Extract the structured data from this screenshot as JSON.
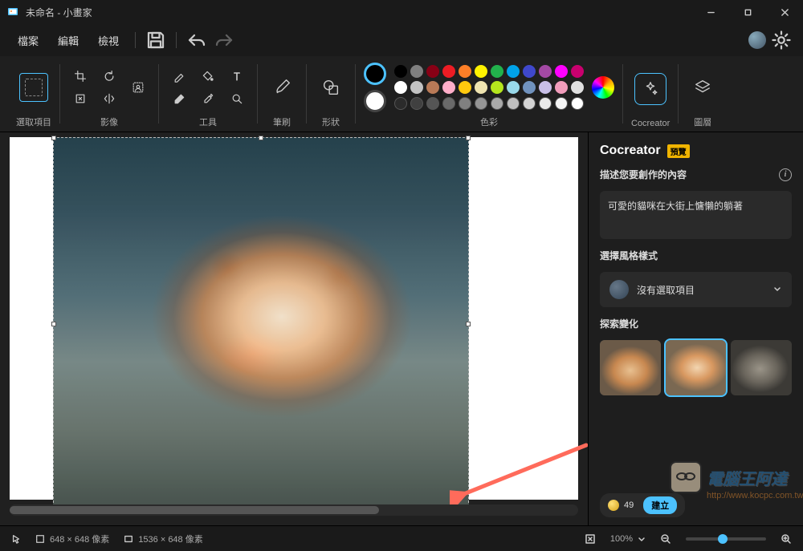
{
  "window": {
    "title": "未命名 - 小畫家"
  },
  "menu": {
    "file": "檔案",
    "edit": "編輯",
    "view": "檢視"
  },
  "ribbon": {
    "selection": "選取項目",
    "image": "影像",
    "tools": "工具",
    "brushes": "筆刷",
    "shapes": "形狀",
    "colors": "色彩",
    "cocreator": "Cocreator",
    "layers": "圖層"
  },
  "palette": {
    "primary": "#000000",
    "secondary": "#ffffff",
    "colors": [
      "#000000",
      "#7f7f7f",
      "#880015",
      "#ed1c24",
      "#ff7f27",
      "#fff200",
      "#22b14c",
      "#00a2e8",
      "#3f48cc",
      "#a349a4",
      "#ff00ff",
      "#c8006e",
      "#ffffff",
      "#c3c3c3",
      "#b97a57",
      "#ffaec9",
      "#ffc90e",
      "#efe4b0",
      "#b5e61d",
      "#99d9ea",
      "#7092be",
      "#c8bfe7",
      "#f19cbb",
      "#e0e0e0",
      "#2b2b2b",
      "#404040",
      "#555555",
      "#6a6a6a",
      "#808080",
      "#959595",
      "#aaaaaa",
      "#bfbfbf",
      "#d4d4d4",
      "#e9e9e9",
      "#f4f4f4",
      "#ffffff"
    ]
  },
  "panel": {
    "title": "Cocreator",
    "badge": "預覽",
    "describe_label": "描述您要創作的內容",
    "prompt": "可愛的貓咪在大街上慵懶的躺著",
    "style_label": "選擇風格樣式",
    "style_value": "沒有選取項目",
    "variants_label": "探索變化",
    "credits": "49",
    "generate": "建立"
  },
  "status": {
    "selection_size": "648 × 648 像素",
    "canvas_size": "1536 × 648 像素",
    "zoom": "100%"
  },
  "watermark": {
    "text": "電腦王阿達",
    "url": "http://www.kocpc.com.tw"
  }
}
